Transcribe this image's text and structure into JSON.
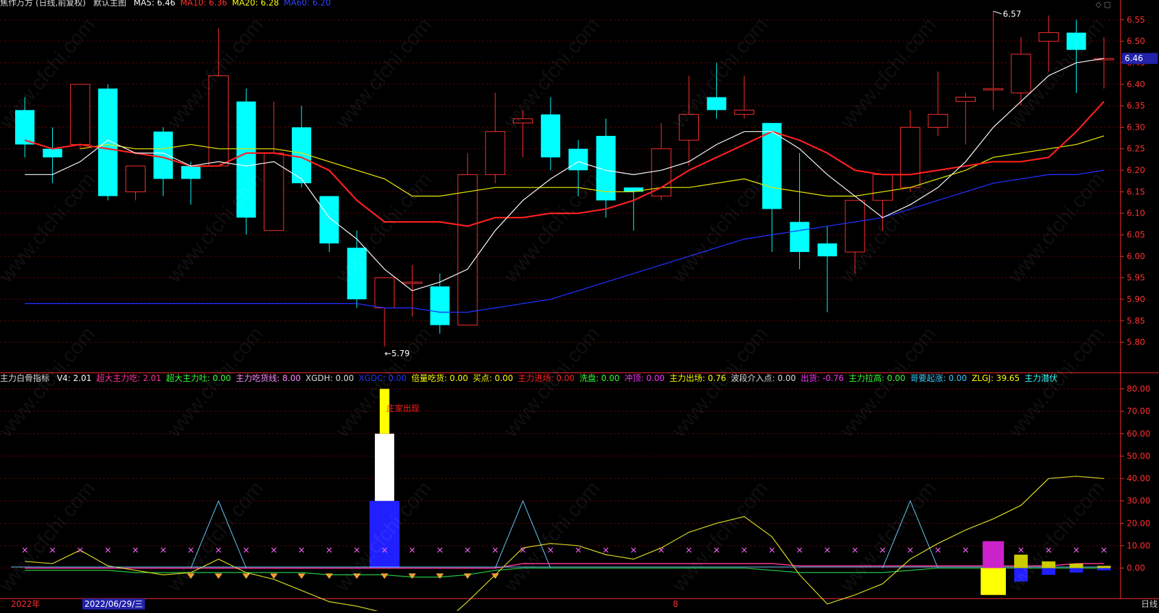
{
  "header": {
    "title": "焦作万方 (日线,前复权)",
    "template": "默认主图",
    "ma": [
      {
        "label": "MA5: 6.46",
        "color": "#ffffff"
      },
      {
        "label": "MA10: 6.36",
        "color": "#ff3030"
      },
      {
        "label": "MA20: 6.28",
        "color": "#ffff00"
      },
      {
        "label": "MA60: 6.20",
        "color": "#3344ff"
      }
    ],
    "icons": [
      "diamond-icon",
      "square-icon"
    ]
  },
  "indicator_header": {
    "name": "主力白骨指标",
    "items": [
      {
        "label": "V4: 2.01",
        "color": "#ffffff"
      },
      {
        "label": "超大主力吃: 2.01",
        "color": "#ff3399"
      },
      {
        "label": "超大主力吐: 0.00",
        "color": "#33ff33"
      },
      {
        "label": "主力吃货线: 8.00",
        "color": "#ff88ff"
      },
      {
        "label": "XGDH: 0.00",
        "color": "#dddddd"
      },
      {
        "label": "XGDC: 0.00",
        "color": "#2233ff"
      },
      {
        "label": "倍量吃货: 0.00",
        "color": "#ffff00"
      },
      {
        "label": "买点: 0.00",
        "color": "#ffff00"
      },
      {
        "label": "主力进场: 0.00",
        "color": "#ff2222"
      },
      {
        "label": "洗盘: 0.00",
        "color": "#33ff33"
      },
      {
        "label": "冲顶: 0.00",
        "color": "#ff33ff"
      },
      {
        "label": "主力出场: 0.76",
        "color": "#ffff00"
      },
      {
        "label": "波段介入点: 0.00",
        "color": "#dddddd"
      },
      {
        "label": "出货: -0.76",
        "color": "#ff33ff"
      },
      {
        "label": "主力拉高: 0.00",
        "color": "#33ff33"
      },
      {
        "label": "哥要起涨: 0.00",
        "color": "#33ccff"
      },
      {
        "label": "ZLGJ: 39.65",
        "color": "#ffff00"
      },
      {
        "label": "主力潜伏",
        "color": "#33ffff"
      }
    ]
  },
  "footer": {
    "year": "2022年",
    "date": "2022/06/29/三",
    "month_mark": "8",
    "period": "日线"
  },
  "watermark": "www.cfchi.com",
  "colors": {
    "up": "#ff3030",
    "down": "#00ffff",
    "grid": "#5a0000",
    "axis": "#ff3030",
    "ma5": "#ffffff",
    "ma10": "#ff2020",
    "ma20": "#e0e000",
    "ma60": "#2030ff"
  },
  "chart_data": [
    {
      "type": "candlestick",
      "title": "",
      "ylim": [
        5.75,
        6.58
      ],
      "yticks": [
        "6.55",
        "6.50",
        "6.45",
        "6.40",
        "6.35",
        "6.30",
        "6.25",
        "6.20",
        "6.15",
        "6.10",
        "6.05",
        "6.00",
        "5.95",
        "5.90",
        "5.85",
        "5.80"
      ],
      "last_price_label": "6.46",
      "annotations": [
        {
          "text": "6.57",
          "index": 35,
          "value": 6.57
        },
        {
          "text": "5.79",
          "index": 13,
          "value": 5.79
        }
      ],
      "candles": [
        {
          "o": 6.34,
          "h": 6.37,
          "l": 6.23,
          "c": 6.26
        },
        {
          "o": 6.25,
          "h": 6.3,
          "l": 6.17,
          "c": 6.23
        },
        {
          "o": 6.26,
          "h": 6.4,
          "l": 6.25,
          "c": 6.4
        },
        {
          "o": 6.39,
          "h": 6.4,
          "l": 6.13,
          "c": 6.14
        },
        {
          "o": 6.15,
          "h": 6.21,
          "l": 6.13,
          "c": 6.21
        },
        {
          "o": 6.29,
          "h": 6.3,
          "l": 6.14,
          "c": 6.18
        },
        {
          "o": 6.21,
          "h": 6.22,
          "l": 6.12,
          "c": 6.18
        },
        {
          "o": 6.21,
          "h": 6.53,
          "l": 6.21,
          "c": 6.42
        },
        {
          "o": 6.36,
          "h": 6.39,
          "l": 6.05,
          "c": 6.09
        },
        {
          "o": 6.06,
          "h": 6.36,
          "l": 6.06,
          "c": 6.24
        },
        {
          "o": 6.3,
          "h": 6.35,
          "l": 6.16,
          "c": 6.17
        },
        {
          "o": 6.14,
          "h": 6.14,
          "l": 6.01,
          "c": 6.03
        },
        {
          "o": 6.02,
          "h": 6.06,
          "l": 5.88,
          "c": 5.9
        },
        {
          "o": 5.88,
          "h": 5.95,
          "l": 5.79,
          "c": 5.95
        },
        {
          "o": 5.94,
          "h": 5.98,
          "l": 5.86,
          "c": 5.94
        },
        {
          "o": 5.93,
          "h": 5.96,
          "l": 5.82,
          "c": 5.84
        },
        {
          "o": 5.84,
          "h": 6.24,
          "l": 5.84,
          "c": 6.19
        },
        {
          "o": 6.19,
          "h": 6.38,
          "l": 6.17,
          "c": 6.29
        },
        {
          "o": 6.31,
          "h": 6.34,
          "l": 6.23,
          "c": 6.32
        },
        {
          "o": 6.33,
          "h": 6.37,
          "l": 6.2,
          "c": 6.23
        },
        {
          "o": 6.25,
          "h": 6.27,
          "l": 6.14,
          "c": 6.2
        },
        {
          "o": 6.28,
          "h": 6.32,
          "l": 6.09,
          "c": 6.13
        },
        {
          "o": 6.16,
          "h": 6.16,
          "l": 6.06,
          "c": 6.15
        },
        {
          "o": 6.14,
          "h": 6.31,
          "l": 6.13,
          "c": 6.25
        },
        {
          "o": 6.27,
          "h": 6.42,
          "l": 6.21,
          "c": 6.33
        },
        {
          "o": 6.37,
          "h": 6.45,
          "l": 6.32,
          "c": 6.34
        },
        {
          "o": 6.33,
          "h": 6.42,
          "l": 6.32,
          "c": 6.34
        },
        {
          "o": 6.31,
          "h": 6.31,
          "l": 6.01,
          "c": 6.11
        },
        {
          "o": 6.08,
          "h": 6.24,
          "l": 5.97,
          "c": 6.01
        },
        {
          "o": 6.03,
          "h": 6.07,
          "l": 5.87,
          "c": 6.0
        },
        {
          "o": 6.01,
          "h": 6.13,
          "l": 5.96,
          "c": 6.13
        },
        {
          "o": 6.13,
          "h": 6.19,
          "l": 6.06,
          "c": 6.19
        },
        {
          "o": 6.16,
          "h": 6.34,
          "l": 6.15,
          "c": 6.3
        },
        {
          "o": 6.3,
          "h": 6.43,
          "l": 6.28,
          "c": 6.33
        },
        {
          "o": 6.36,
          "h": 6.38,
          "l": 6.26,
          "c": 6.37
        },
        {
          "o": 6.39,
          "h": 6.57,
          "l": 6.34,
          "c": 6.39
        },
        {
          "o": 6.38,
          "h": 6.51,
          "l": 6.35,
          "c": 6.47
        },
        {
          "o": 6.5,
          "h": 6.56,
          "l": 6.43,
          "c": 6.52
        },
        {
          "o": 6.52,
          "h": 6.55,
          "l": 6.38,
          "c": 6.48
        },
        {
          "o": 6.46,
          "h": 6.51,
          "l": 6.39,
          "c": 6.46
        }
      ],
      "ma5": [
        6.19,
        6.19,
        6.22,
        6.27,
        6.24,
        6.24,
        6.21,
        6.22,
        6.21,
        6.22,
        6.18,
        6.09,
        6.04,
        5.97,
        5.92,
        5.94,
        5.97,
        6.06,
        6.13,
        6.18,
        6.22,
        6.2,
        6.19,
        6.2,
        6.22,
        6.26,
        6.29,
        6.29,
        6.25,
        6.19,
        6.14,
        6.09,
        6.12,
        6.16,
        6.22,
        6.3,
        6.36,
        6.42,
        6.45,
        6.46
      ],
      "ma10": [
        6.27,
        6.25,
        6.26,
        6.25,
        6.24,
        6.23,
        6.21,
        6.21,
        6.24,
        6.24,
        6.23,
        6.2,
        6.13,
        6.08,
        6.08,
        6.08,
        6.07,
        6.09,
        6.09,
        6.1,
        6.1,
        6.11,
        6.13,
        6.16,
        6.2,
        6.23,
        6.26,
        6.29,
        6.27,
        6.24,
        6.2,
        6.19,
        6.19,
        6.2,
        6.21,
        6.22,
        6.22,
        6.23,
        6.29,
        6.36
      ],
      "ma20": [
        null,
        null,
        6.25,
        6.26,
        6.25,
        6.25,
        6.26,
        6.25,
        6.25,
        6.25,
        6.24,
        6.22,
        6.2,
        6.18,
        6.14,
        6.14,
        6.15,
        6.16,
        6.16,
        6.16,
        6.16,
        6.15,
        6.15,
        6.16,
        6.16,
        6.17,
        6.18,
        6.16,
        6.15,
        6.14,
        6.14,
        6.15,
        6.16,
        6.18,
        6.2,
        6.23,
        6.24,
        6.25,
        6.26,
        6.28
      ],
      "ma60": [
        5.89,
        5.89,
        5.89,
        5.89,
        5.89,
        5.89,
        5.89,
        5.89,
        5.89,
        5.89,
        5.89,
        5.89,
        5.89,
        5.88,
        5.88,
        5.87,
        5.87,
        5.88,
        5.89,
        5.9,
        5.92,
        5.94,
        5.96,
        5.98,
        6.0,
        6.02,
        6.04,
        6.05,
        6.06,
        6.07,
        6.08,
        6.09,
        6.11,
        6.13,
        6.15,
        6.17,
        6.18,
        6.19,
        6.19,
        6.2
      ]
    },
    {
      "type": "bar",
      "title": "",
      "ylim": [
        -13,
        82
      ],
      "yticks": [
        "80.00",
        "70.00",
        "60.00",
        "50.00",
        "40.00",
        "30.00",
        "20.00",
        "10.00",
        "0.00"
      ],
      "label_text": "庄家出现",
      "big_bar": {
        "index": 13,
        "segments": [
          {
            "from": 0,
            "to": 30,
            "color": "#2020ff"
          },
          {
            "from": 30,
            "to": 60,
            "color": "#ffffff"
          },
          {
            "from": 60,
            "to": 80,
            "color": "#ffff00"
          }
        ]
      },
      "zlgj": [
        3,
        2,
        8,
        1,
        -1,
        -3,
        -2,
        4,
        -2,
        -5,
        -10,
        -15,
        -17,
        -20,
        -22,
        -26,
        -15,
        -3,
        9,
        11,
        10,
        6,
        4,
        9,
        16,
        20,
        23,
        14,
        -3,
        -16,
        -12,
        -7,
        4,
        11,
        17,
        22,
        28,
        40,
        41,
        40
      ],
      "spikes": [
        {
          "index": 7,
          "value": 30
        },
        {
          "index": 18,
          "value": 30
        },
        {
          "index": 32,
          "value": 30
        }
      ],
      "markers_x": [
        0,
        1,
        2,
        3,
        4,
        5,
        6,
        7,
        8,
        9,
        10,
        11,
        12,
        13,
        14,
        15,
        16,
        17,
        18,
        19,
        20,
        21,
        22,
        23,
        24,
        25,
        26,
        27,
        28,
        29,
        30,
        31,
        32,
        33,
        34,
        35,
        36,
        37,
        38,
        39
      ],
      "diamonds": [
        6,
        7,
        8,
        9,
        10,
        11,
        12,
        13,
        14,
        15,
        16,
        17
      ],
      "pink_line": [
        0,
        0,
        0,
        0,
        0,
        0,
        0,
        0,
        0,
        0,
        0,
        0,
        0,
        0,
        0,
        0,
        0,
        0,
        2,
        2,
        2,
        2,
        2,
        2,
        2,
        2,
        2,
        2,
        1,
        1,
        1,
        1,
        1,
        1,
        1,
        1,
        1,
        1,
        2,
        2
      ],
      "green_line": [
        -1,
        -1,
        -1,
        -1,
        -2,
        -2,
        -2,
        -2,
        -2,
        -2,
        -2,
        -3,
        -3,
        -3,
        -4,
        -4,
        -3,
        -1,
        0,
        0,
        0,
        0,
        0,
        0,
        0,
        0,
        0,
        -1,
        -2,
        -2,
        -2,
        -2,
        -1,
        0,
        0,
        0,
        0,
        0,
        0,
        0
      ],
      "tail_bars": [
        {
          "index": 35,
          "pos": 12,
          "neg": -12,
          "posColor": "#cc22cc",
          "negColor": "#ffff00"
        },
        {
          "index": 36,
          "pos": 6,
          "neg": -6,
          "posColor": "#cccc00",
          "negColor": "#2020ff"
        },
        {
          "index": 37,
          "pos": 3,
          "neg": -3,
          "posColor": "#cccc00",
          "negColor": "#2020ff"
        },
        {
          "index": 38,
          "pos": 2,
          "neg": -2,
          "posColor": "#cccc00",
          "negColor": "#2020ff"
        },
        {
          "index": 39,
          "pos": 1,
          "neg": -1,
          "posColor": "#cccc00",
          "negColor": "#2020ff"
        }
      ]
    }
  ]
}
